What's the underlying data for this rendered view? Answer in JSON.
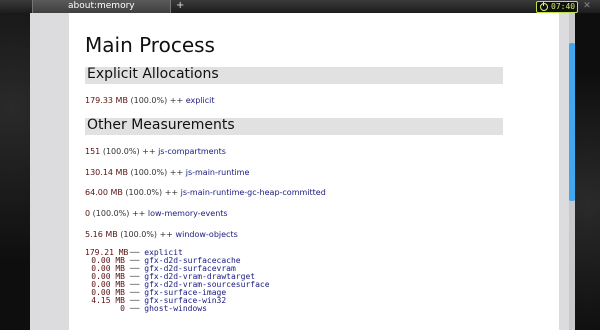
{
  "browser": {
    "tab_title": "about:memory",
    "new_tab_label": "+",
    "clock": "07:40",
    "close_label": "✕"
  },
  "page": {
    "process_title": "Main Process",
    "explicit_section": {
      "title": "Explicit Allocations",
      "entry": {
        "value": "179.33 MB",
        "percent": "(100.0%)",
        "marker": "++",
        "name": "explicit"
      }
    },
    "other_section": {
      "title": "Other Measurements",
      "entries": [
        {
          "value": "151",
          "percent": "(100.0%)",
          "marker": "++",
          "name": "js-compartments"
        },
        {
          "value": "130.14 MB",
          "percent": "(100.0%)",
          "marker": "++",
          "name": "js-main-runtime"
        },
        {
          "value": "64.00 MB",
          "percent": "(100.0%)",
          "marker": "++",
          "name": "js-main-runtime-gc-heap-committed"
        },
        {
          "value": "0",
          "percent": "(100.0%)",
          "marker": "++",
          "name": "low-memory-events"
        },
        {
          "value": "5.16 MB",
          "percent": "(100.0%)",
          "marker": "++",
          "name": "window-objects"
        }
      ]
    },
    "tree": [
      {
        "value": "179.21 MB",
        "connector": "──",
        "name": "explicit"
      },
      {
        "value": "0.00 MB",
        "connector": "──",
        "name": "gfx-d2d-surfacecache"
      },
      {
        "value": "0.00 MB",
        "connector": "──",
        "name": "gfx-d2d-surfacevram"
      },
      {
        "value": "0.00 MB",
        "connector": "──",
        "name": "gfx-d2d-vram-drawtarget"
      },
      {
        "value": "0.00 MB",
        "connector": "──",
        "name": "gfx-d2d-vram-sourcesurface"
      },
      {
        "value": "0.00 MB",
        "connector": "──",
        "name": "gfx-surface-image"
      },
      {
        "value": "4.15 MB",
        "connector": "──",
        "name": "gfx-surface-win32"
      },
      {
        "value": "0",
        "connector": "──",
        "name": "ghost-windows"
      }
    ]
  },
  "colors": {
    "accent_scroll": "#3fa8f0",
    "clock_green": "#d8f070",
    "value_color": "#5a1010",
    "name_color": "#1a1a80"
  }
}
